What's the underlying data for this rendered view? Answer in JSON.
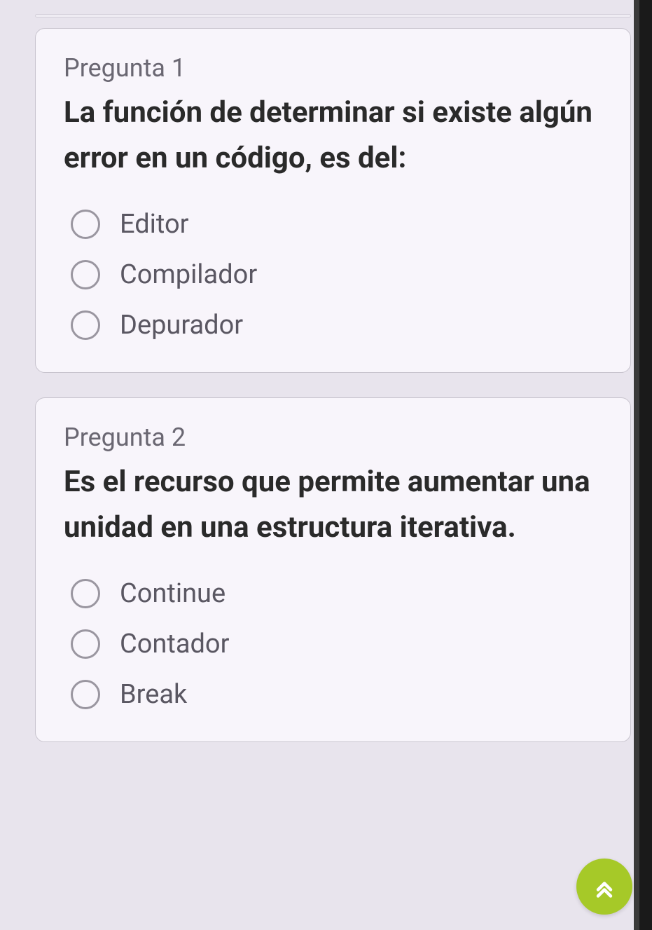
{
  "questions": [
    {
      "number": "Pregunta 1",
      "text": "La función de determinar si existe algún error en un código, es del:",
      "options": [
        "Editor",
        "Compilador",
        "Depurador"
      ]
    },
    {
      "number": "Pregunta 2",
      "text": "Es el recurso que permite aumentar una unidad en una estructura iterativa.",
      "options": [
        "Continue",
        "Contador",
        "Break"
      ]
    }
  ],
  "scrollTopIcon": "double-chevron-up"
}
